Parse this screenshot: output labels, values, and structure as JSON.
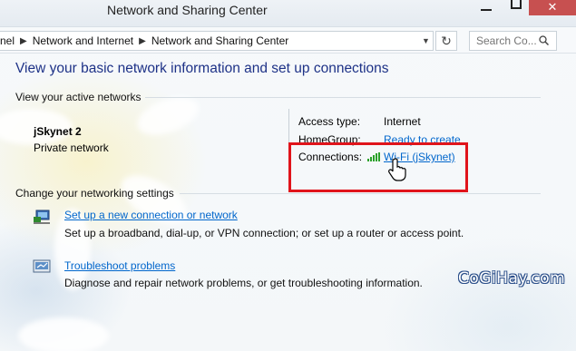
{
  "window": {
    "title": "Network and Sharing Center",
    "close_glyph": "✕"
  },
  "address": {
    "crumbs": [
      "nel",
      "Network and Internet",
      "Network and Sharing Center"
    ],
    "search_placeholder": "Search Co..."
  },
  "main": {
    "heading": "View your basic network information and set up connections",
    "active_networks_header": "View your active networks",
    "network": {
      "name": "jSkynet  2",
      "category": "Private network",
      "access_type_label": "Access type:",
      "access_type_value": "Internet",
      "homegroup_label": "HomeGroup:",
      "homegroup_value": "Ready to create",
      "connections_label": "Connections:",
      "connections_value": "Wi-Fi (jSkynet)"
    },
    "change_settings_header": "Change your networking settings",
    "tasks": [
      {
        "icon": "network-setup-icon",
        "link": "Set up a new connection or network",
        "description": "Set up a broadband, dial-up, or VPN connection; or set up a router or access point."
      },
      {
        "icon": "troubleshoot-icon",
        "link": "Troubleshoot problems",
        "description": "Diagnose and repair network problems, or get troubleshooting information."
      }
    ]
  },
  "watermark": "CoGiHay.com",
  "colors": {
    "heading": "#1e3287",
    "link": "#0066cc",
    "highlight_box": "#e0141b",
    "signal": "#2aa12a"
  }
}
